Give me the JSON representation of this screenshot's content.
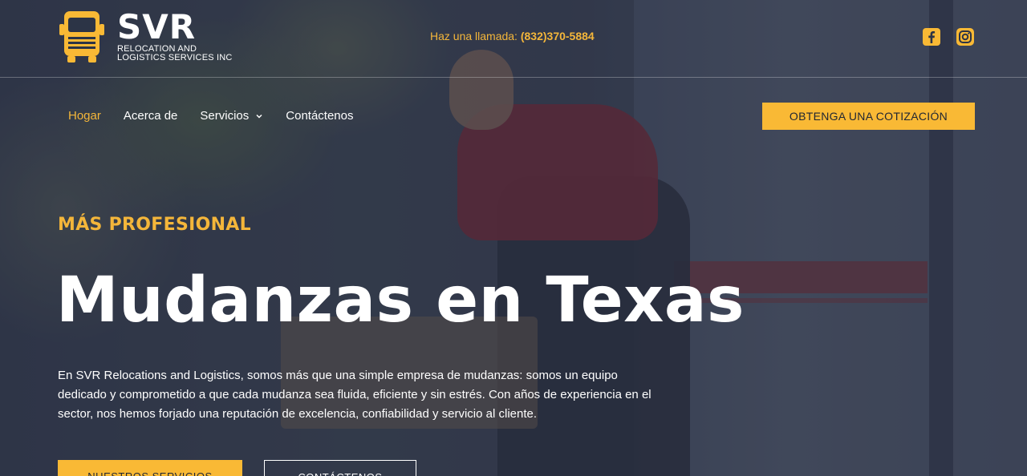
{
  "brand": {
    "name": "SVR",
    "tagline_line1": "RELOCATION AND",
    "tagline_line2": "LOGISTICS SERVICES INC",
    "logo_icon": "truck-icon",
    "accent_color": "#f9b935"
  },
  "header": {
    "call_label": "Haz una llamada:",
    "phone": "(832)370-5884"
  },
  "social": [
    {
      "name": "facebook-icon"
    },
    {
      "name": "instagram-icon"
    }
  ],
  "nav": {
    "items": [
      {
        "label": "Hogar",
        "active": true
      },
      {
        "label": "Acerca de"
      },
      {
        "label": "Servicios",
        "has_dropdown": true
      },
      {
        "label": "Contáctenos"
      }
    ],
    "cta": "OBTENGA UNA COTIZACIÓN"
  },
  "hero": {
    "eyebrow": "MÁS PROFESIONAL",
    "title": "Mudanzas en Texas",
    "body_line1": "En SVR Relocations and Logistics, somos más que una simple empresa de mudanzas: somos un equipo",
    "body_line2": "dedicado y comprometido a que cada mudanza sea fluida, eficiente y sin estrés. Con años de experiencia en el",
    "body_line3": "sector, nos hemos forjado una reputación de excelencia, confiabilidad y servicio al cliente.",
    "primary_button": "NUESTROS SERVICIOS",
    "secondary_button": "CONTÁCTENOS"
  }
}
